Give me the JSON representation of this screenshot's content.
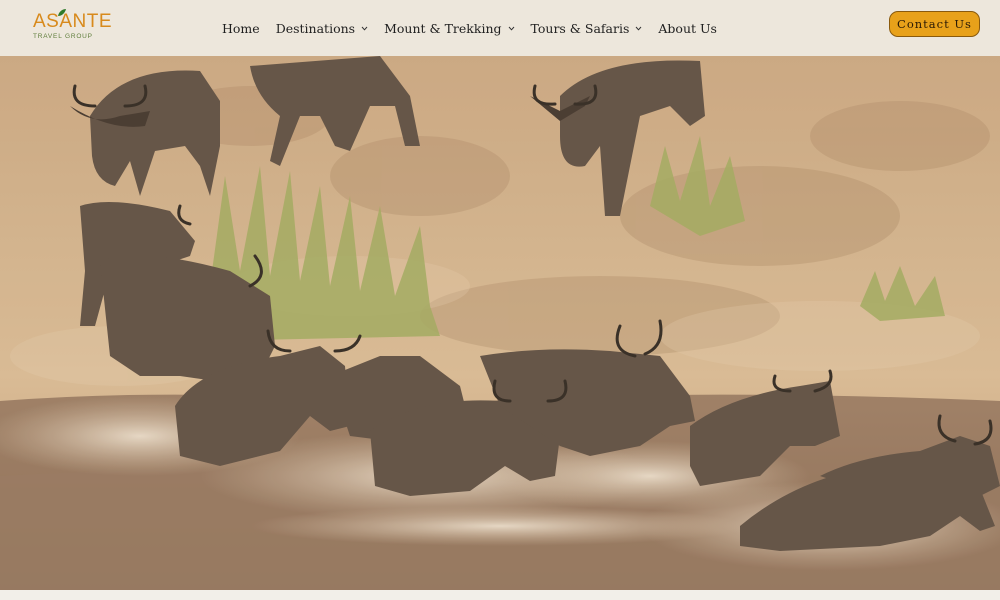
{
  "brand": {
    "name": "ASANTE",
    "tagline": "TRAVEL GROUP",
    "leaf_color": "#2f7a2a",
    "accent": "#d88a1c"
  },
  "nav": {
    "items": [
      {
        "label": "Home",
        "has_dropdown": false
      },
      {
        "label": "Destinations",
        "has_dropdown": true
      },
      {
        "label": "Mount & Trekking",
        "has_dropdown": true
      },
      {
        "label": "Tours & Safaris",
        "has_dropdown": true
      },
      {
        "label": "About Us",
        "has_dropdown": false
      }
    ]
  },
  "cta": {
    "label": "Contact Us",
    "color": "#e8a11a"
  },
  "hero": {
    "image_icon": "wildebeest-river-crossing-photo"
  }
}
